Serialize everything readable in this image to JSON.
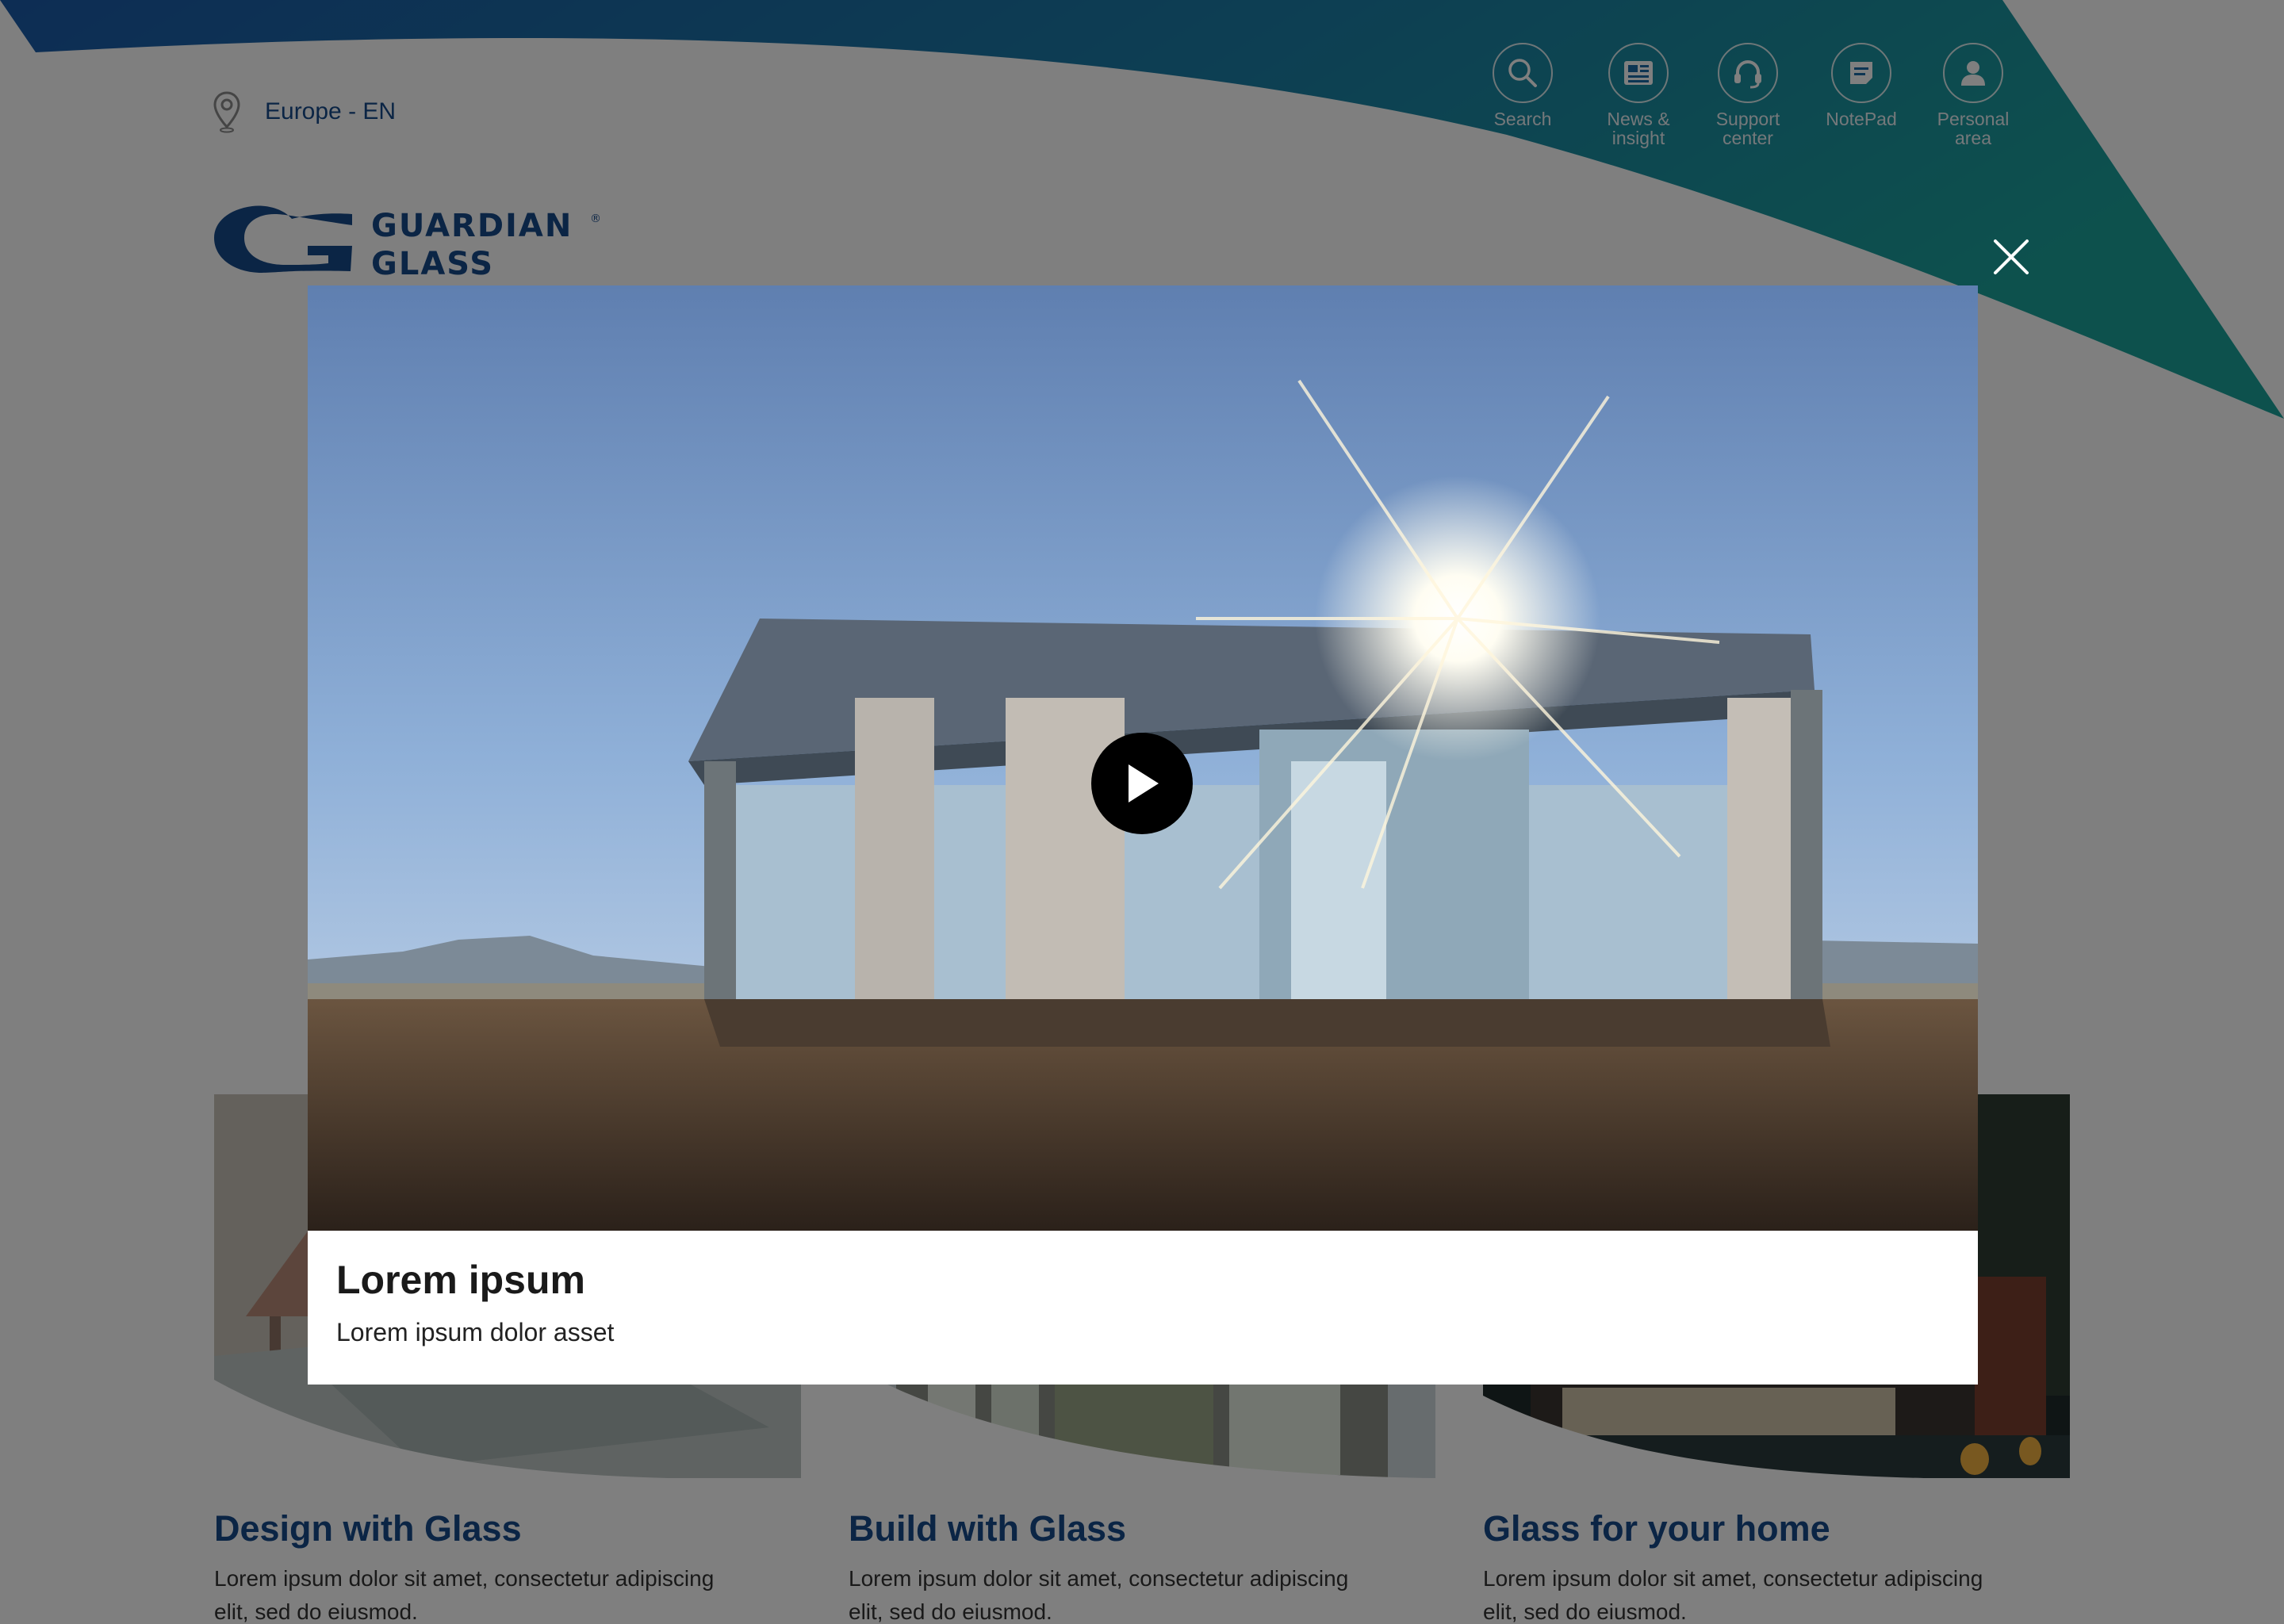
{
  "colors": {
    "brand_blue": "#174a8b",
    "swoosh_start": "#1a5aa8",
    "swoosh_end": "#1aa39b",
    "overlay": "#000000"
  },
  "header": {
    "locale": "Europe - EN",
    "locale_icon": "map-pin-icon",
    "logo": {
      "line1": "GUARDIAN",
      "line2": "GLASS",
      "mark": "®"
    }
  },
  "utility_nav": [
    {
      "id": "search",
      "label_lines": [
        "Search"
      ],
      "icon": "search-icon"
    },
    {
      "id": "news",
      "label_lines": [
        "News &",
        "insight"
      ],
      "icon": "newspaper-icon"
    },
    {
      "id": "support",
      "label_lines": [
        "Support",
        "center"
      ],
      "icon": "headset-icon"
    },
    {
      "id": "notepad",
      "label_lines": [
        "NotePad"
      ],
      "icon": "note-icon"
    },
    {
      "id": "personal",
      "label_lines": [
        "Personal",
        "area"
      ],
      "icon": "user-icon"
    }
  ],
  "cards": [
    {
      "title": "Design with Glass",
      "body": "Lorem ipsum dolor sit amet, consectetur adipiscing elit, sed do eiusmod."
    },
    {
      "title": "Build with Glass",
      "body": "Lorem ipsum dolor sit amet, consectetur adipiscing elit, sed do eiusmod."
    },
    {
      "title": "Glass for your home",
      "body": "Lorem ipsum dolor sit amet, consectetur adipiscing elit, sed do eiusmod."
    }
  ],
  "modal": {
    "title": "Lorem ipsum",
    "subtitle": "Lorem ipsum dolor asset",
    "close_icon": "close-icon",
    "play_icon": "play-icon"
  }
}
